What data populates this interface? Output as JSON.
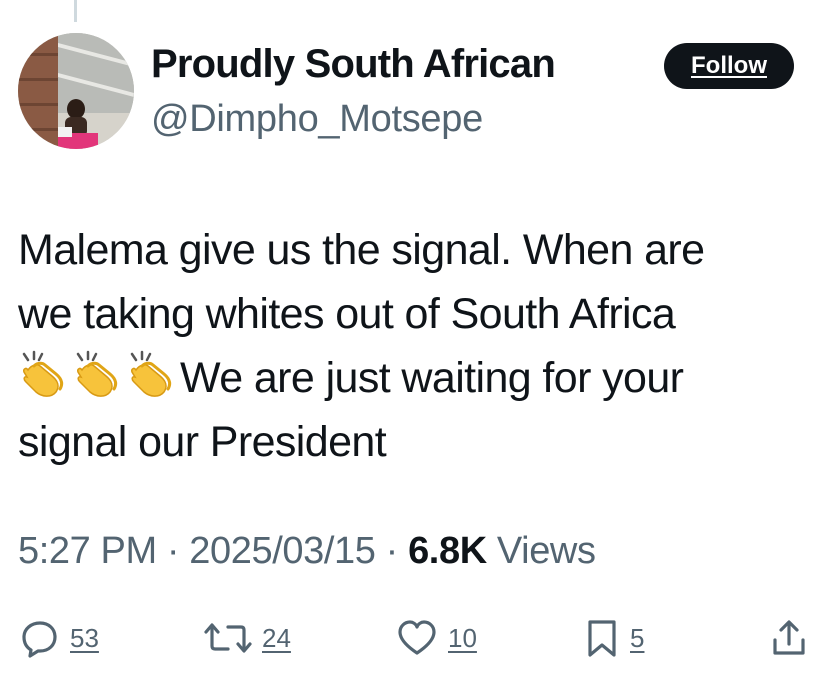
{
  "author": {
    "display_name": "Proudly South African",
    "handle": "@Dimpho_Motsepe",
    "follow_label": "Follow"
  },
  "tweet": {
    "line1": "Malema give us the signal. When are",
    "line2": "we taking whites out of South Africa",
    "emojis": [
      "clapping-hands",
      "clapping-hands",
      "clapping-hands"
    ],
    "line3": "We are just waiting for your",
    "line4": "signal our President"
  },
  "meta": {
    "time": "5:27 PM",
    "separator": " · ",
    "date": "2025/03/15",
    "views_count": "6.8K",
    "views_label": " Views"
  },
  "actions": {
    "replies": {
      "icon": "reply-icon",
      "count": "53"
    },
    "reposts": {
      "icon": "repost-icon",
      "count": "24"
    },
    "likes": {
      "icon": "heart-icon",
      "count": "10"
    },
    "bookmarks": {
      "icon": "bookmark-icon",
      "count": "5"
    },
    "share": {
      "icon": "share-icon"
    }
  },
  "colors": {
    "text": "#0f1419",
    "secondary": "#536471",
    "follow_bg": "#0f1419",
    "follow_text": "#ffffff"
  }
}
